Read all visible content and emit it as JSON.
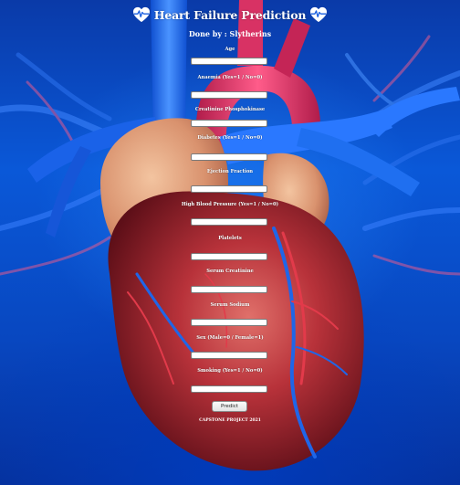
{
  "app": {
    "title": "Heart Failure Prediction",
    "subtitle": "Done by : Slytherins",
    "footer": "CAPSTONE PROJECT 2021"
  },
  "icons": {
    "left": "heartbeat-icon",
    "right": "heartbeat-icon"
  },
  "fields": [
    {
      "label": "Age",
      "value": ""
    },
    {
      "label": "Anaemia (Yes=1 / No=0)",
      "value": ""
    },
    {
      "label": "Creatinine Phosphokinase",
      "value": ""
    },
    {
      "label": "Diabetes (Yes=1 / No=0)",
      "value": ""
    },
    {
      "label": "Ejection Fraction",
      "value": ""
    },
    {
      "label": "High Blood Pressure (Yes=1 / No=0)",
      "value": ""
    },
    {
      "label": "Platelets",
      "value": ""
    },
    {
      "label": "Serum Creatinine",
      "value": ""
    },
    {
      "label": "Serum Sodium",
      "value": ""
    },
    {
      "label": "Sex (Male=0 / Female=1)",
      "value": ""
    },
    {
      "label": "Smoking (Yes=1 / No=0)",
      "value": ""
    }
  ],
  "buttons": {
    "predict_label": "Predict"
  },
  "colors": {
    "background_blue": "#0a58d8",
    "heart_red": "#b8323a",
    "artery_pink": "#e0306a",
    "vein_blue": "#1f6ff0"
  }
}
